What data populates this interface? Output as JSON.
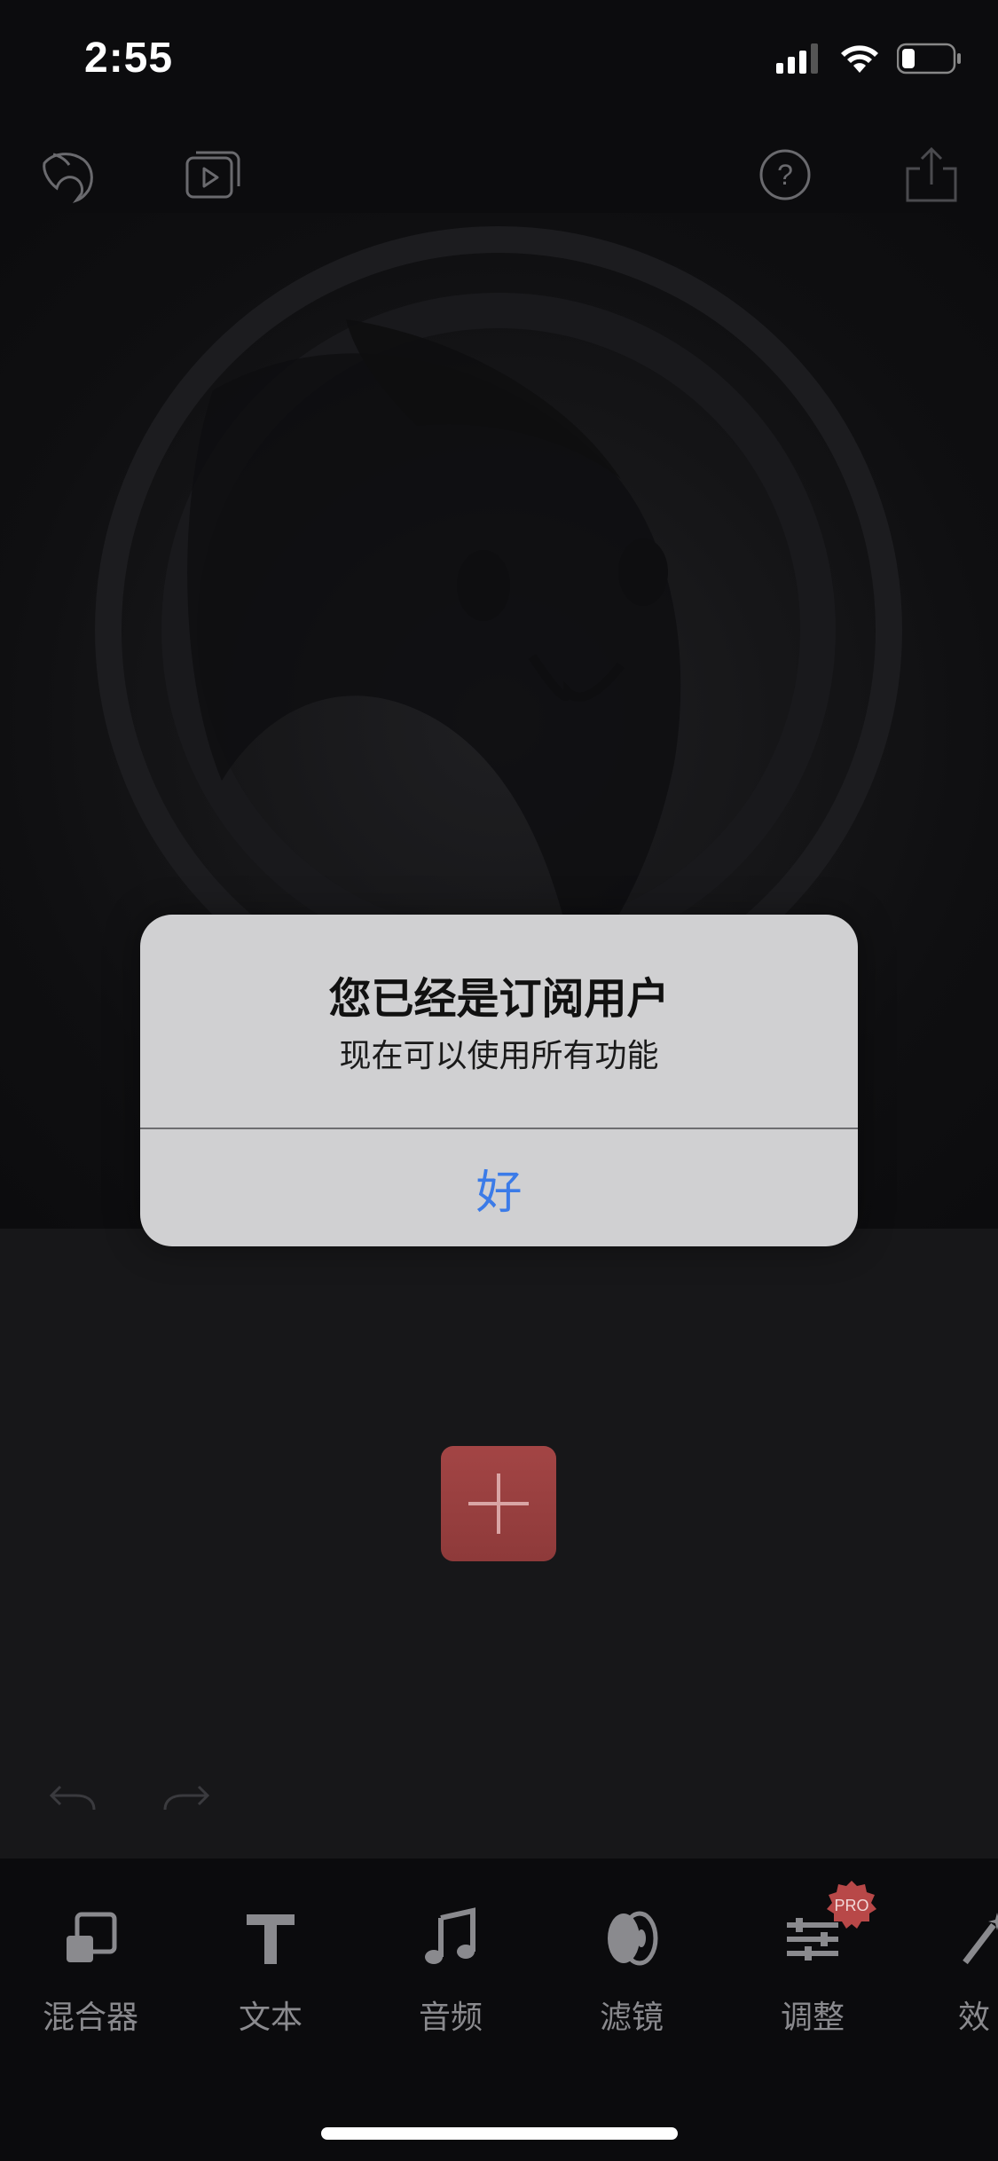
{
  "status_bar": {
    "time": "2:55"
  },
  "toolbar": {
    "icons": [
      "rabbit-logo-icon",
      "media-library-icon",
      "help-icon",
      "share-icon"
    ]
  },
  "alert": {
    "title": "您已经是订阅用户",
    "message": "现在可以使用所有功能",
    "button_label": "好"
  },
  "bottom_tools": [
    {
      "label": "混合器",
      "icon": "mixer-icon"
    },
    {
      "label": "文本",
      "icon": "text-icon"
    },
    {
      "label": "音频",
      "icon": "music-note-icon"
    },
    {
      "label": "滤镜",
      "icon": "filter-icon"
    },
    {
      "label": "调整",
      "icon": "sliders-icon"
    },
    {
      "label": "效",
      "icon": "magic-wand-icon"
    }
  ],
  "pro_badge": "PRO",
  "colors": {
    "accent_red": "#a34545",
    "alert_button_blue": "#3b7be8",
    "background": "#0c0c0e"
  }
}
